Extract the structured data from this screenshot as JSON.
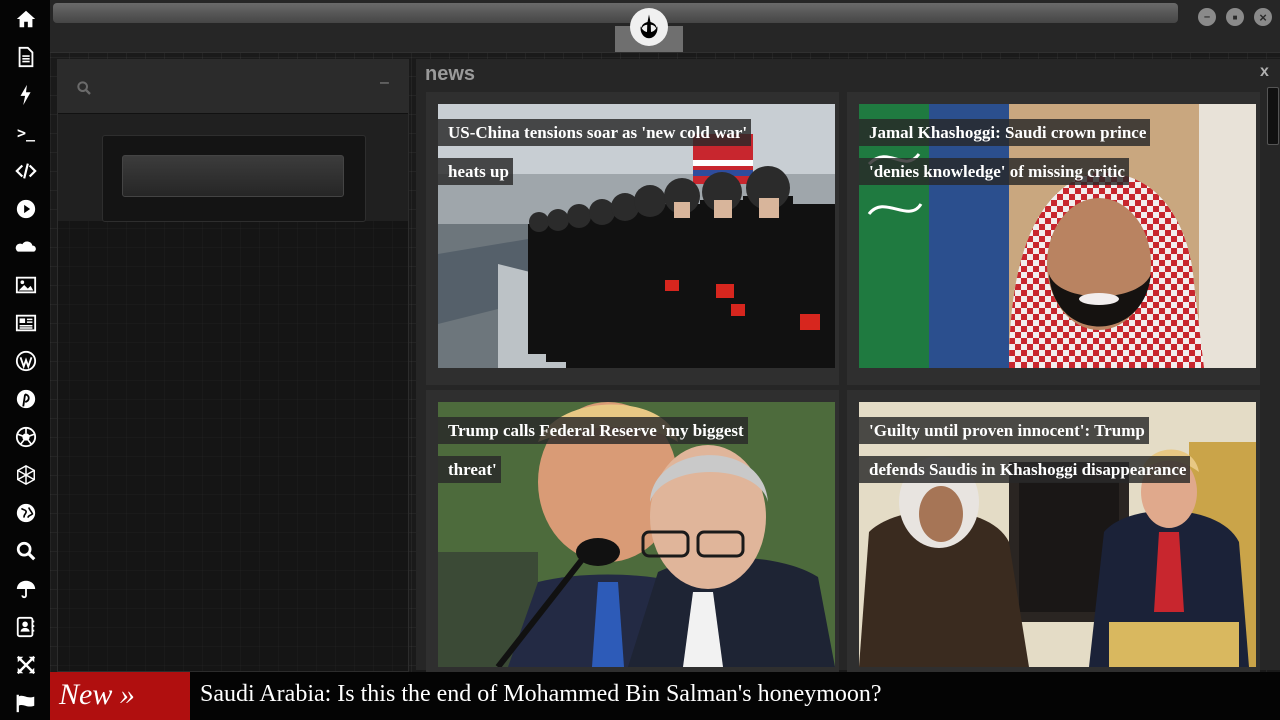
{
  "dock": {
    "icons": [
      "home-icon",
      "document-icon",
      "lightning-icon",
      "terminal-icon",
      "code-icon",
      "play-icon",
      "cloud-icon",
      "image-icon",
      "newspaper-icon",
      "wordpress-icon",
      "pinterest-icon",
      "aperture-icon",
      "network-icon",
      "globe-icon",
      "search-icon",
      "umbrella-icon",
      "contacts-icon",
      "expand-icon",
      "flag-icon"
    ],
    "terminal_glyph": ">_"
  },
  "topbar": {
    "logo": "rebel-alliance-logo",
    "minimize_glyph": "–",
    "maximize_glyph": "■",
    "close_glyph": "×"
  },
  "left_panel": {
    "minimize_glyph": "–"
  },
  "news": {
    "title": "news",
    "close_glyph": "x",
    "cards": [
      {
        "headline": "US-China tensions soar as 'new cold war' heats up"
      },
      {
        "headline": "Jamal Khashoggi: Saudi crown prince 'denies knowledge' of missing critic"
      },
      {
        "headline": "Trump calls Federal Reserve 'my biggest threat'"
      },
      {
        "headline": "'Guilty until proven innocent': Trump defends Saudis in Khashoggi disappearance"
      }
    ]
  },
  "ticker": {
    "label": "New »",
    "headline": "Saudi Arabia: Is this the end of Mohammed Bin Salman's honeymoon?"
  },
  "colors": {
    "ticker_accent": "#b00f0f",
    "panel_bg": "#262626",
    "dock_bg": "#050505"
  }
}
